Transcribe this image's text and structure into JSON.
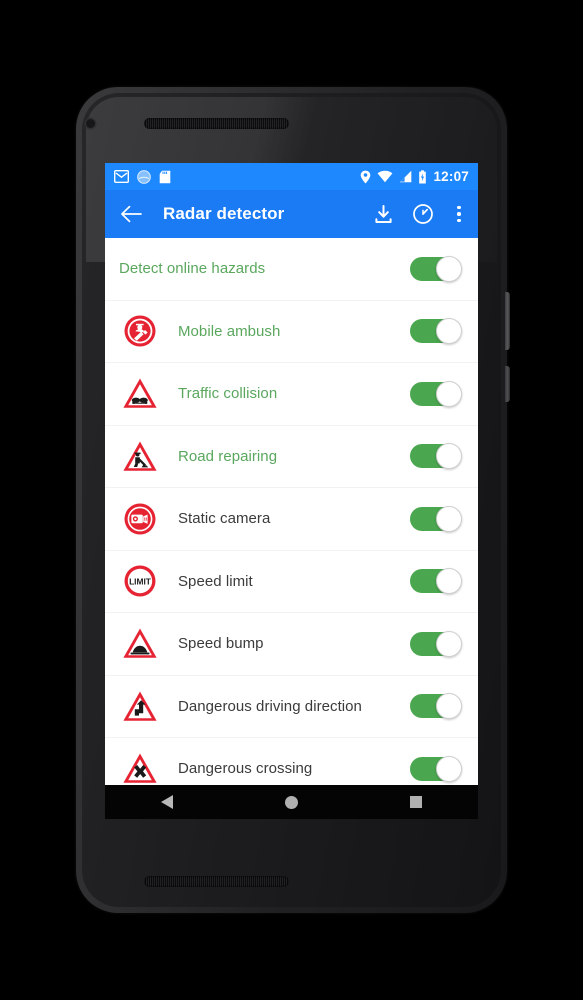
{
  "device": {
    "front_camera": "front-camera",
    "earpiece": "earpiece-speaker",
    "bottom_speaker": "bottom-speaker"
  },
  "status_bar": {
    "background_color": "#1e88ff",
    "left_icons": [
      "gmail-icon",
      "circle-sync-icon",
      "sd-card-icon"
    ],
    "right_icons": [
      "location-pin-icon",
      "wifi-icon",
      "cell-signal-icon",
      "battery-icon"
    ],
    "clock": "12:07"
  },
  "app_bar": {
    "background_color": "#1a7bf5",
    "back_label": "back-arrow",
    "title": "Radar detector",
    "actions": [
      {
        "name": "download-icon"
      },
      {
        "name": "speedometer-icon"
      },
      {
        "name": "overflow-menu-icon"
      }
    ]
  },
  "settings": {
    "accent_on_color": "#4aa64f",
    "enabled_text_color": "#5aa75e",
    "disabled_text_color": "#3b3b3b",
    "rows": [
      {
        "label": "Detect online hazards",
        "icon": "none",
        "text_style": "green",
        "toggle": "on"
      },
      {
        "label": "Mobile ambush",
        "icon": "police-officer-sign-icon",
        "text_style": "green",
        "toggle": "on"
      },
      {
        "label": "Traffic collision",
        "icon": "car-crash-warning-sign-icon",
        "text_style": "green",
        "toggle": "on"
      },
      {
        "label": "Road repairing",
        "icon": "roadworks-warning-sign-icon",
        "text_style": "green",
        "toggle": "on"
      },
      {
        "label": "Static camera",
        "icon": "speed-camera-sign-icon",
        "text_style": "dark",
        "toggle": "on"
      },
      {
        "label": "Speed limit",
        "icon": "speed-limit-sign-icon",
        "text_style": "dark",
        "toggle": "on"
      },
      {
        "label": "Speed bump",
        "icon": "speed-bump-warning-sign-icon",
        "text_style": "dark",
        "toggle": "on"
      },
      {
        "label": "Dangerous driving direction",
        "icon": "double-bend-warning-sign-icon",
        "text_style": "dark",
        "toggle": "on"
      },
      {
        "label": "Dangerous crossing",
        "icon": "crossroads-warning-sign-icon",
        "text_style": "dark",
        "toggle": "on"
      }
    ]
  },
  "nav_bar": {
    "background_color": "#040404",
    "buttons": [
      {
        "name": "nav-back-button",
        "glyph": "triangle-left"
      },
      {
        "name": "nav-home-button",
        "glyph": "circle"
      },
      {
        "name": "nav-recents-button",
        "glyph": "square"
      }
    ]
  },
  "sign_text": {
    "speed_limit": "LIMIT"
  }
}
